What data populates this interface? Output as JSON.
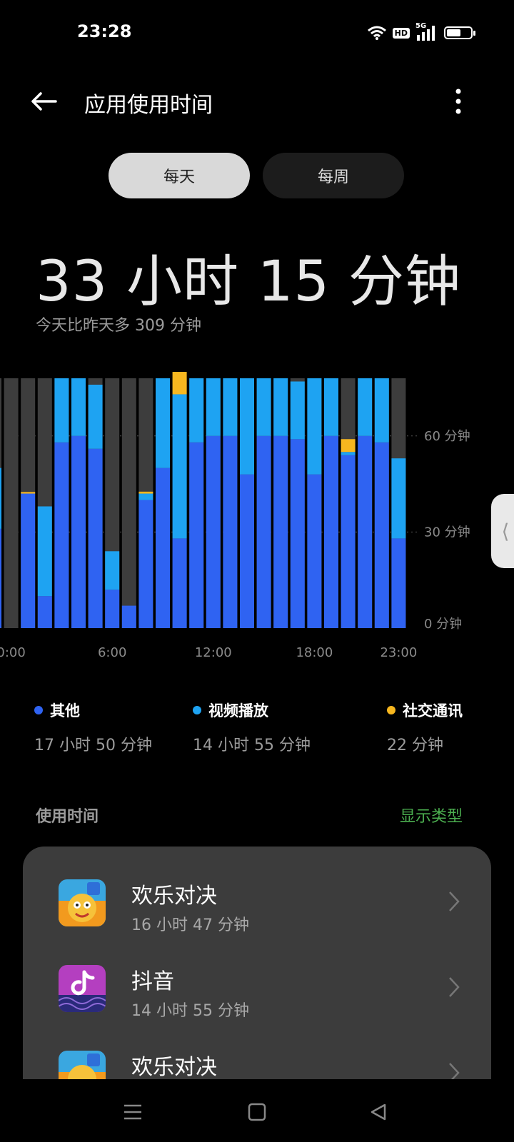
{
  "status_bar": {
    "time": "23:28",
    "icons": [
      "wifi-icon",
      "hd-icon",
      "5g-signal-icon",
      "battery-icon"
    ],
    "hd_label": "HD",
    "network_label": "5G",
    "battery_level": 0.6
  },
  "header": {
    "title": "应用使用时间",
    "back_icon": "arrow-left-icon",
    "more_icon": "more-vertical-icon"
  },
  "tabs": {
    "daily": "每天",
    "weekly": "每周",
    "selected": "daily"
  },
  "summary": {
    "total": "33 小时 15 分钟",
    "compare": "今天比昨天多 309 分钟"
  },
  "colors": {
    "other": "#2f63f2",
    "video": "#1ea3f2",
    "social": "#f7b71f",
    "empty": "#3d3d3d",
    "accent_green": "#4caf50"
  },
  "chart_data": {
    "type": "bar",
    "stacked": true,
    "x_tick_labels": [
      "0:00",
      "6:00",
      "12:00",
      "18:00",
      "23:00"
    ],
    "y_tick_labels": [
      "60 分钟",
      "30 分钟",
      "0 分钟"
    ],
    "y_ticks": [
      60,
      30,
      0
    ],
    "ylim": [
      0,
      78
    ],
    "grid": true,
    "categories": [
      "23:00(prev)",
      "0:00",
      "1:00",
      "2:00",
      "3:00",
      "4:00",
      "5:00",
      "6:00",
      "7:00",
      "8:00",
      "9:00",
      "10:00",
      "11:00",
      "12:00",
      "13:00",
      "14:00",
      "15:00",
      "16:00",
      "17:00",
      "18:00",
      "19:00",
      "20:00",
      "21:00",
      "22:00",
      "23:00"
    ],
    "series": [
      {
        "name": "其他",
        "values": [
          31,
          0,
          42,
          10,
          58,
          60,
          56,
          12,
          7,
          40,
          50,
          28,
          58,
          60,
          60,
          48,
          60,
          60,
          59,
          48,
          60,
          54,
          60,
          58,
          28
        ]
      },
      {
        "name": "视频播放",
        "values": [
          19,
          0,
          0,
          28,
          20,
          18,
          20,
          12,
          0,
          2,
          28,
          45,
          20,
          18,
          18,
          30,
          18,
          18,
          18,
          30,
          18,
          1,
          18,
          20,
          25
        ]
      },
      {
        "name": "社交通讯",
        "values": [
          0,
          0,
          0.5,
          0,
          0,
          0,
          0,
          0,
          0,
          0.6,
          0,
          7,
          0,
          0,
          0,
          0,
          0,
          0,
          0,
          0,
          0,
          4,
          0,
          0,
          0
        ]
      }
    ]
  },
  "legend": [
    {
      "name": "其他",
      "value": "17 小时 50 分钟"
    },
    {
      "name": "视频播放",
      "value": "14 小时 55 分钟"
    },
    {
      "name": "社交通讯",
      "value": "22 分钟"
    }
  ],
  "usage_section": {
    "label": "使用时间",
    "action": "显示类型"
  },
  "apps": [
    {
      "name": "欢乐对决",
      "time": "16 小时 47 分钟",
      "icon": "game-app-icon"
    },
    {
      "name": "抖音",
      "time": "14 小时 55 分钟",
      "icon": "douyin-app-icon"
    },
    {
      "name": "欢乐对决",
      "time": "",
      "icon": "game-app-icon"
    }
  ],
  "nav": {
    "icons": [
      "menu-icon",
      "home-icon",
      "back-triangle-icon"
    ]
  },
  "side_handle_glyph": "⟨"
}
